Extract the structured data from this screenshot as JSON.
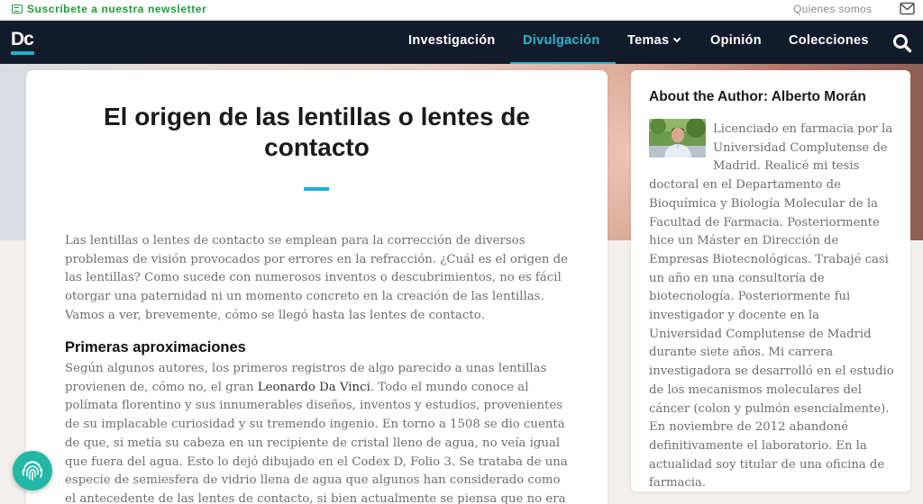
{
  "topbar": {
    "newsletter_label": "Suscríbete a nuestra newsletter",
    "quienes_label": "Quienes somos",
    "newsletter_color": "#1f9a3a"
  },
  "nav": {
    "logo_text": "Dc",
    "items": [
      {
        "label": "Investigación"
      },
      {
        "label": "Divulgación",
        "active": true
      },
      {
        "label": "Temas",
        "dropdown": true
      },
      {
        "label": "Opinión"
      },
      {
        "label": "Colecciones"
      }
    ],
    "accent_color": "#2bb6d2",
    "background": "#121b2a"
  },
  "article": {
    "title": "El origen de las lentillas o lentes de contacto",
    "intro": "Las lentillas o lentes de contacto se emplean para la corrección de diversos problemas de visión provocados por errores en la refracción. ¿Cuál es el origen de las lentillas? Como sucede con numerosos inventos o descubrimientos, no es fácil otorgar una paternidad ni un momento concreto en la creación de las lentillas. Vamos a ver, brevemente, cómo se llegó hasta las lentes de contacto.",
    "section_heading": "Primeras aproximaciones",
    "body_before": "Según algunos autores, los primeros registros de algo parecido a unas lentillas provienen de, cómo no, el gran ",
    "body_name": "Leonardo Da Vinci",
    "body_after": ". Todo el mundo conoce al polímata florentino y sus innumerables diseños, inventos y estudios, provenientes de su implacable curiosidad y su tremendo ingenio. En torno a 1508 se dio cuenta de que, si metía su cabeza en un recipiente de cristal lleno de agua, no veía igual que fuera del agua. Esto lo dejó dibujado en el Codex D, Folio 3. Se trataba de una especie de semiesfera de vidrio llena de agua que algunos han considerado como el antecedente de las lentes de contacto, si bien actualmente se piensa que no era un prototipo sino"
  },
  "author": {
    "heading": "About the Author: Alberto Morán",
    "bio": "Licenciado en farmacia por la Universidad Complutense de Madrid. Realicé mi tesis doctoral en el Departamento de Bioquímica y Biología Molecular de la Facultad de Farmacia. Posteriormente hice un Máster en Dirección de Empresas Biotecnológicas. Trabajé casi un año en una consultoría de biotecnología. Posteriormente fui investigador y docente en la Universidad Complutense de Madrid durante siete años. Mi carrera investigadora se desarrolló en el estudio de los mecanismos moleculares del cáncer (colon y pulmón esencialmente). En noviembre de 2012 abandoné definitivamente el laboratorio. En la actualidad soy titular de una oficina de farmacia."
  },
  "icons": {
    "newsletter": "newsletter-icon",
    "mail": "mail-icon",
    "search": "search-icon",
    "dropdown": "chevron-down-icon",
    "badge": "fingerprint-icon"
  },
  "badge_color": "#22b8a5"
}
